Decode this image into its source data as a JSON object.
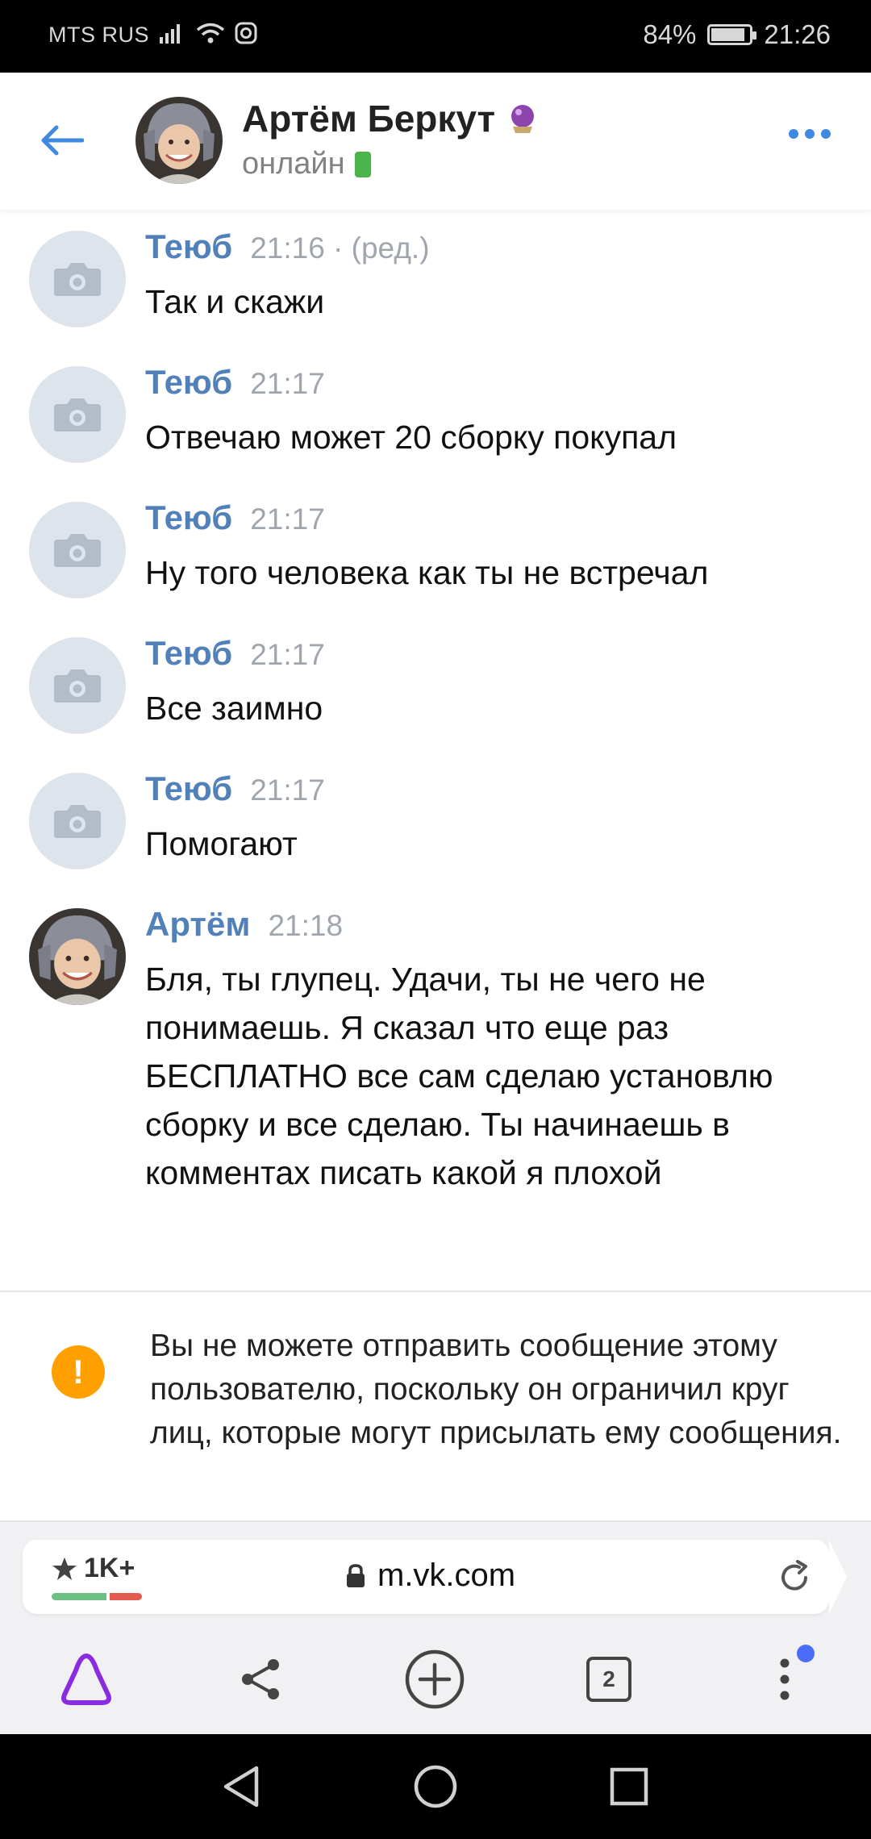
{
  "status_bar": {
    "carrier": "MTS RUS",
    "battery_percent": "84%",
    "battery_level": 0.84,
    "time": "21:26"
  },
  "header": {
    "name": "Артём Беркут",
    "badge_icon": "crystal-ball-icon",
    "status": "онлайн",
    "status_icon": "mobile-online-icon",
    "accent": "#3f8ae0"
  },
  "messages": [
    {
      "author": "Теюб",
      "time": "21:16 · (ред.)",
      "text": "Так и скажи",
      "avatar": "camera-placeholder"
    },
    {
      "author": "Теюб",
      "time": "21:17",
      "text": "Отвечаю может 20 сборку покупал",
      "avatar": "camera-placeholder"
    },
    {
      "author": "Теюб",
      "time": "21:17",
      "text": "Ну того человека как ты не встречал",
      "avatar": "camera-placeholder"
    },
    {
      "author": "Теюб",
      "time": "21:17",
      "text": "Все заимно",
      "avatar": "camera-placeholder"
    },
    {
      "author": "Теюб",
      "time": "21:17",
      "text": "Помогают",
      "avatar": "camera-placeholder"
    },
    {
      "author": "Артём",
      "time": "21:18",
      "text": "Бля, ты глупец. Удачи, ты не чего не понимаешь. Я сказал что еще раз БЕСПЛАТНО все сам сделаю установлю сборку и все сделаю. Ты начинаешь в комментах писать какой я плохой",
      "avatar": "user-photo"
    }
  ],
  "notice": {
    "icon": "warning-icon",
    "symbol": "!",
    "text": "Вы не можете отправить сообщение этому пользователю, поскольку он ограничил круг лиц, которые могут присылать ему сообщения.",
    "color": "#ffa000"
  },
  "browser": {
    "rating": "1K+",
    "url": "m.vk.com",
    "tabs_count": "2",
    "alice_color": "#8a2be2",
    "badge_color": "#4a6cf7"
  },
  "colors": {
    "author": "#5181b8",
    "time": "#a0a6ae",
    "avatar_placeholder": "#dde4ec"
  }
}
